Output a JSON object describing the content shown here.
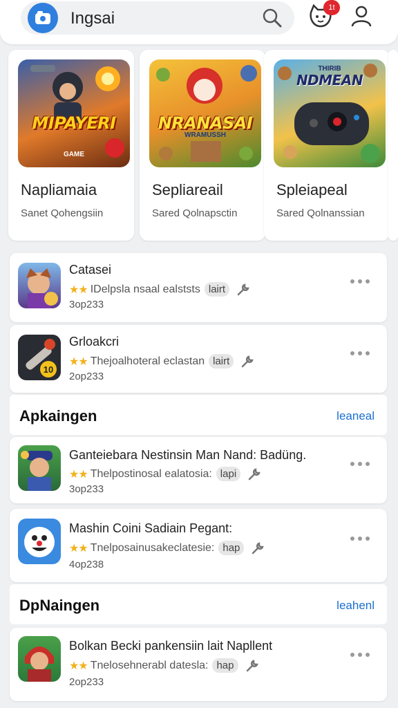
{
  "search": {
    "query": "Ingsai",
    "notification_count": "1t"
  },
  "featured": [
    {
      "title": "Napliamaia",
      "subtitle": "Sanet Qohengsiin",
      "banner": "MIPAYERI",
      "banner_sub": "GAME"
    },
    {
      "title": "Sepliareail",
      "subtitle": "Sared Qolnapsctin",
      "banner": "NRANASAI",
      "banner_sub": "WRAMUSSH"
    },
    {
      "title": "Spleiapeal",
      "subtitle": "Sared Qolnanssian",
      "banner": "NDMEAN",
      "banner_sub": "THIRIB"
    }
  ],
  "list_top": [
    {
      "name": "Catasei",
      "desc": "IDelpsla nsaal ealststs",
      "tag": "lairt",
      "size": "3op233",
      "stars": "★★"
    },
    {
      "name": "Grloakcri",
      "desc": "Thejoalhoteral eclastan",
      "tag": "lairt",
      "size": "2op233",
      "stars": "★★"
    }
  ],
  "section1": {
    "title": "Apkaingen",
    "link": "leaneal"
  },
  "list_mid": [
    {
      "name": "Ganteiebara Nestinsin Man Nand: Badüng.",
      "desc": "Thelpostinosal ealatosia:",
      "tag": "lapi",
      "size": "3op233",
      "stars": "★★"
    },
    {
      "name": "Mashin Coini Sadiain Pegant:",
      "desc": "Tnelposainusakeclatesie:",
      "tag": "hap",
      "size": "4op238",
      "stars": "★★"
    }
  ],
  "section2": {
    "title": "DpNaingen",
    "link": "leahenl"
  },
  "list_bottom": [
    {
      "name": "Bolkan Becki pankensiin lait Napllent",
      "desc": "Tnelosehnerabl datesla:",
      "tag": "hap",
      "size": "2op233",
      "stars": "★★"
    }
  ],
  "colors": {
    "accent": "#2f7fde",
    "link": "#1a6fd0",
    "badge": "#e0262e",
    "star": "#f2b21c"
  },
  "icons": [
    "app-logo-icon",
    "search-icon",
    "notification-mascot-icon",
    "profile-icon",
    "wrench-icon",
    "more-dots-icon"
  ]
}
